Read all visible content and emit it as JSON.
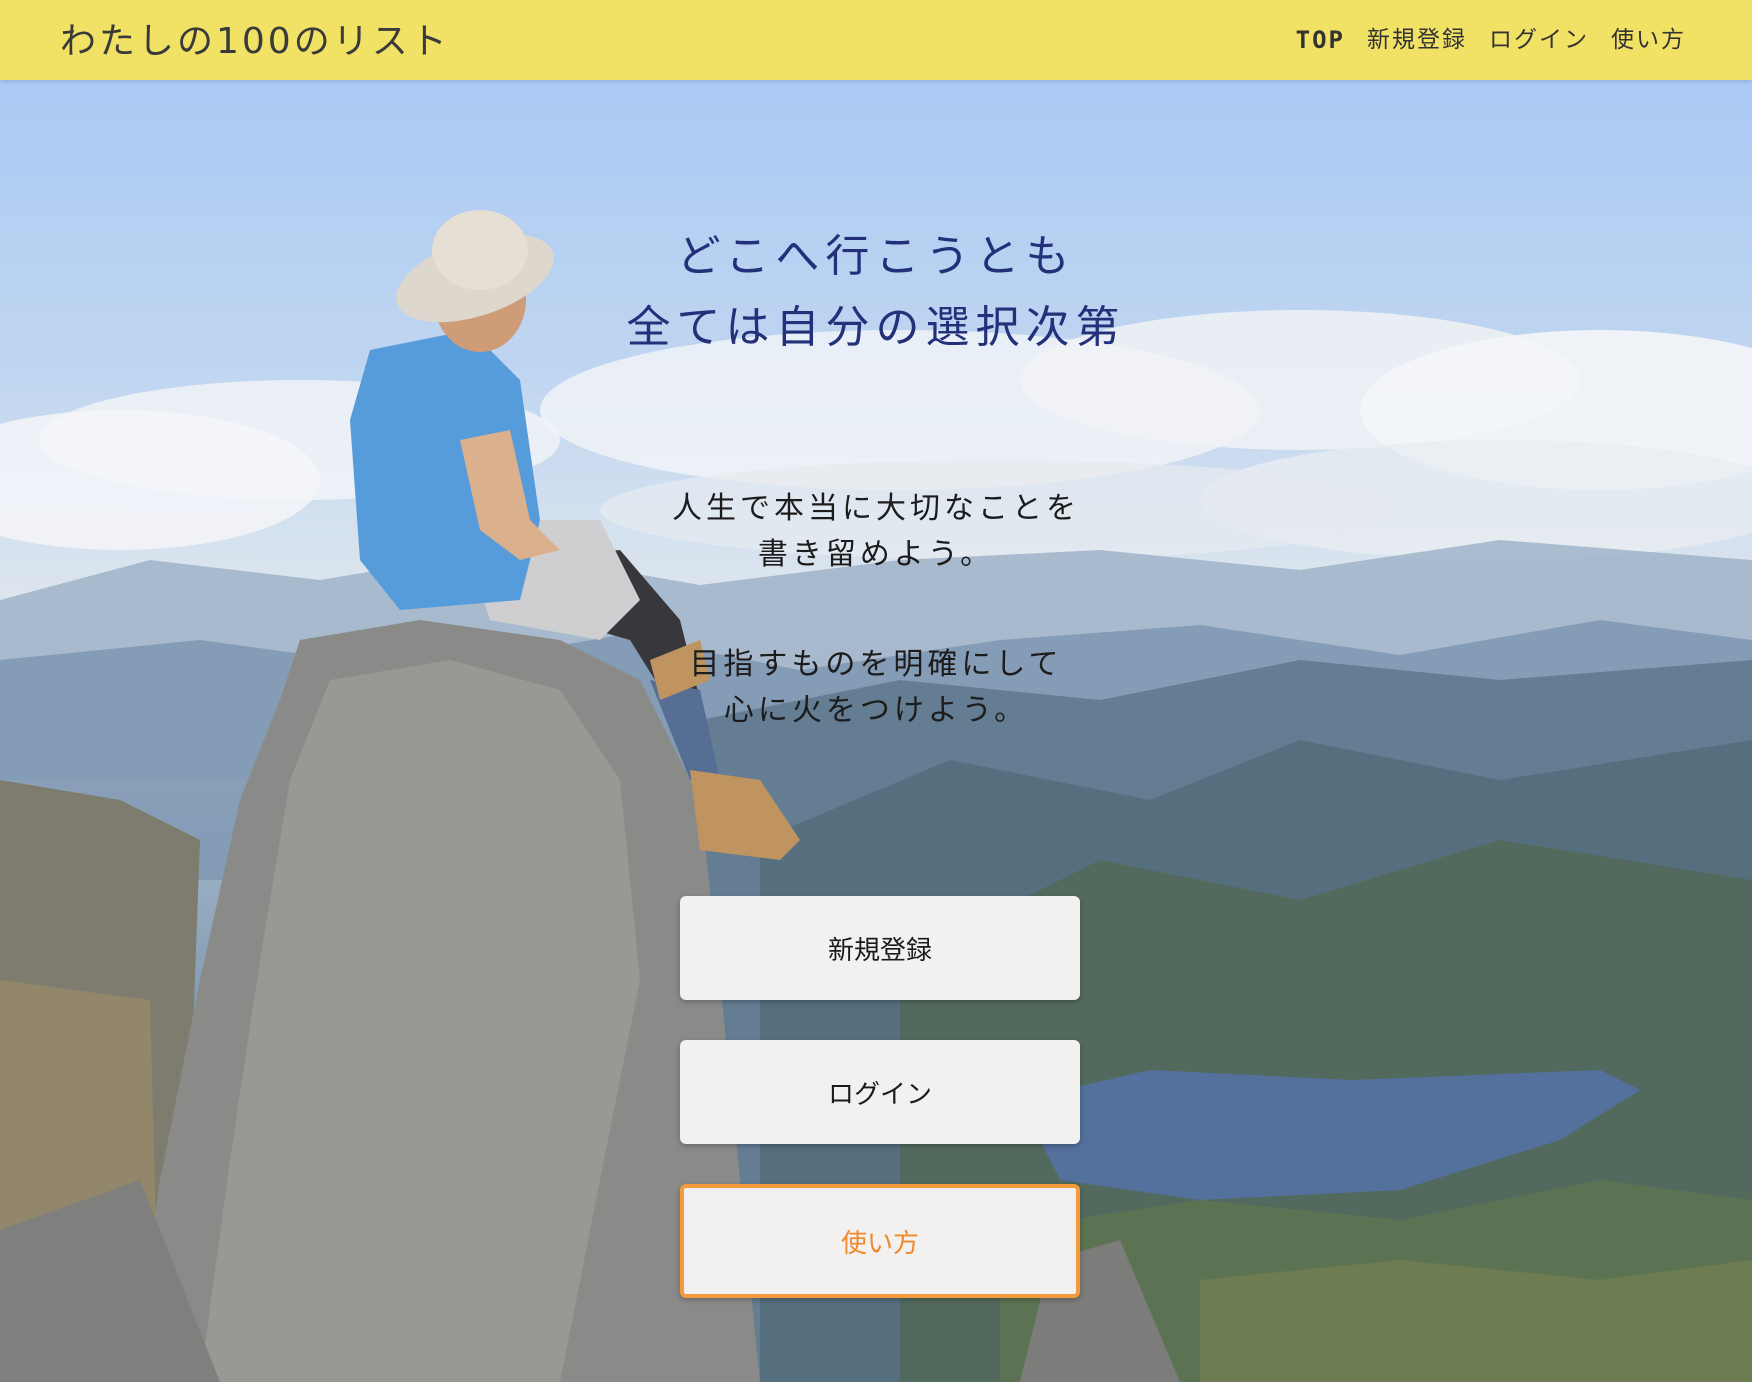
{
  "header": {
    "logo": "わたしの100のリスト",
    "nav": [
      {
        "label": "TOP"
      },
      {
        "label": "新規登録"
      },
      {
        "label": "ログイン"
      },
      {
        "label": "使い方"
      }
    ]
  },
  "hero": {
    "headline_line1": "どこへ行こうとも",
    "headline_line2": "全ては自分の選択次第",
    "paragraph1_line1": "人生で本当に大切なことを",
    "paragraph1_line2": "書き留めよう。",
    "paragraph2_line1": "目指すものを明確にして",
    "paragraph2_line2": "心に火をつけよう。"
  },
  "buttons": {
    "register": "新規登録",
    "login": "ログイン",
    "howto": "使い方"
  },
  "colors": {
    "header_bg": "#f1e265",
    "headline": "#23307a",
    "howto_accent": "#f39a3c",
    "button_bg": "#f2f1ef"
  },
  "background_image": "hiker-sitting-on-rock-overlooking-mountains-and-lake"
}
